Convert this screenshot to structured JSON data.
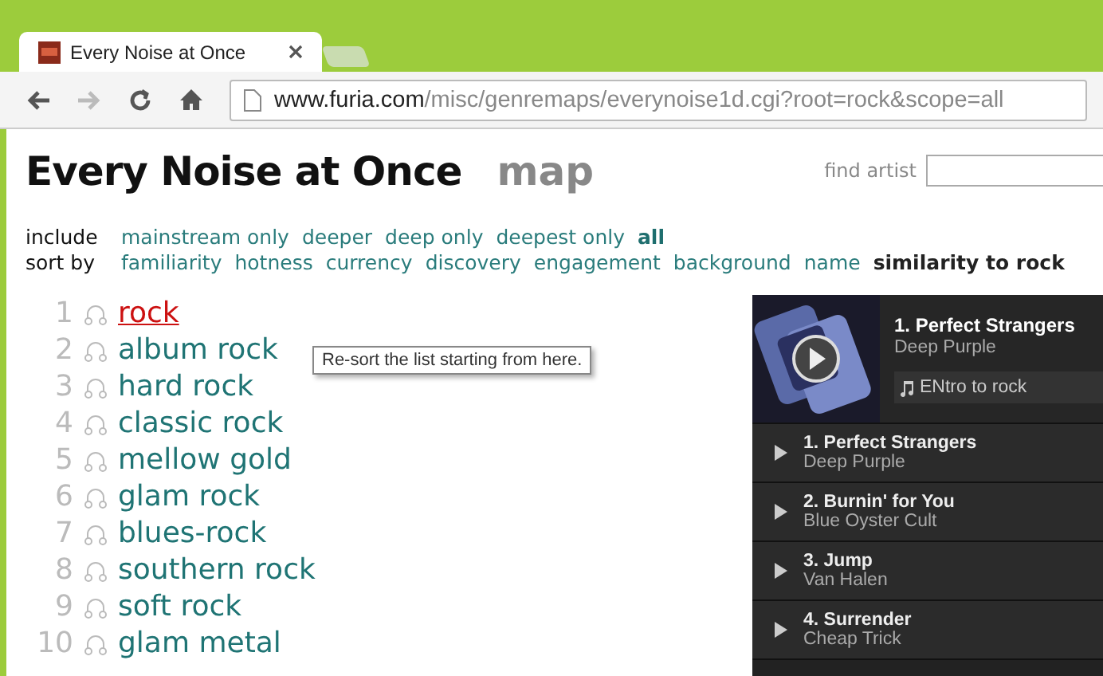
{
  "browser": {
    "tab_title": "Every Noise at Once",
    "url_host": "www.furia.com",
    "url_path": "/misc/genremaps/everynoise1d.cgi?root=rock&scope=all"
  },
  "header": {
    "title": "Every Noise at Once",
    "map_link": "map",
    "find_label": "find artist"
  },
  "include": {
    "label": "include",
    "options": [
      {
        "label": "mainstream only",
        "selected": false
      },
      {
        "label": "deeper",
        "selected": false
      },
      {
        "label": "deep only",
        "selected": false
      },
      {
        "label": "deepest only",
        "selected": false
      },
      {
        "label": "all",
        "selected": true
      }
    ]
  },
  "sort": {
    "label": "sort by",
    "options": [
      {
        "label": "familiarity",
        "selected": false
      },
      {
        "label": "hotness",
        "selected": false
      },
      {
        "label": "currency",
        "selected": false
      },
      {
        "label": "discovery",
        "selected": false
      },
      {
        "label": "engagement",
        "selected": false
      },
      {
        "label": "background",
        "selected": false
      },
      {
        "label": "name",
        "selected": false
      },
      {
        "label": "similarity to rock",
        "selected": true
      }
    ]
  },
  "genres": [
    {
      "rank": "1",
      "name": "rock",
      "hovered": true
    },
    {
      "rank": "2",
      "name": "album rock",
      "hovered": false
    },
    {
      "rank": "3",
      "name": "hard rock",
      "hovered": false
    },
    {
      "rank": "4",
      "name": "classic rock",
      "hovered": false
    },
    {
      "rank": "5",
      "name": "mellow gold",
      "hovered": false
    },
    {
      "rank": "6",
      "name": "glam rock",
      "hovered": false
    },
    {
      "rank": "7",
      "name": "blues-rock",
      "hovered": false
    },
    {
      "rank": "8",
      "name": "southern rock",
      "hovered": false
    },
    {
      "rank": "9",
      "name": "soft rock",
      "hovered": false
    },
    {
      "rank": "10",
      "name": "glam metal",
      "hovered": false
    }
  ],
  "tooltip": "Re-sort the list starting from here.",
  "player": {
    "now_title": "1. Perfect Strangers",
    "now_artist": "Deep Purple",
    "playlist": "ENtro to rock",
    "tracks": [
      {
        "title": "1. Perfect Strangers",
        "artist": "Deep Purple"
      },
      {
        "title": "2. Burnin' for You",
        "artist": "Blue Oyster Cult"
      },
      {
        "title": "3. Jump",
        "artist": "Van Halen"
      },
      {
        "title": "4. Surrender",
        "artist": "Cheap Trick"
      }
    ]
  }
}
